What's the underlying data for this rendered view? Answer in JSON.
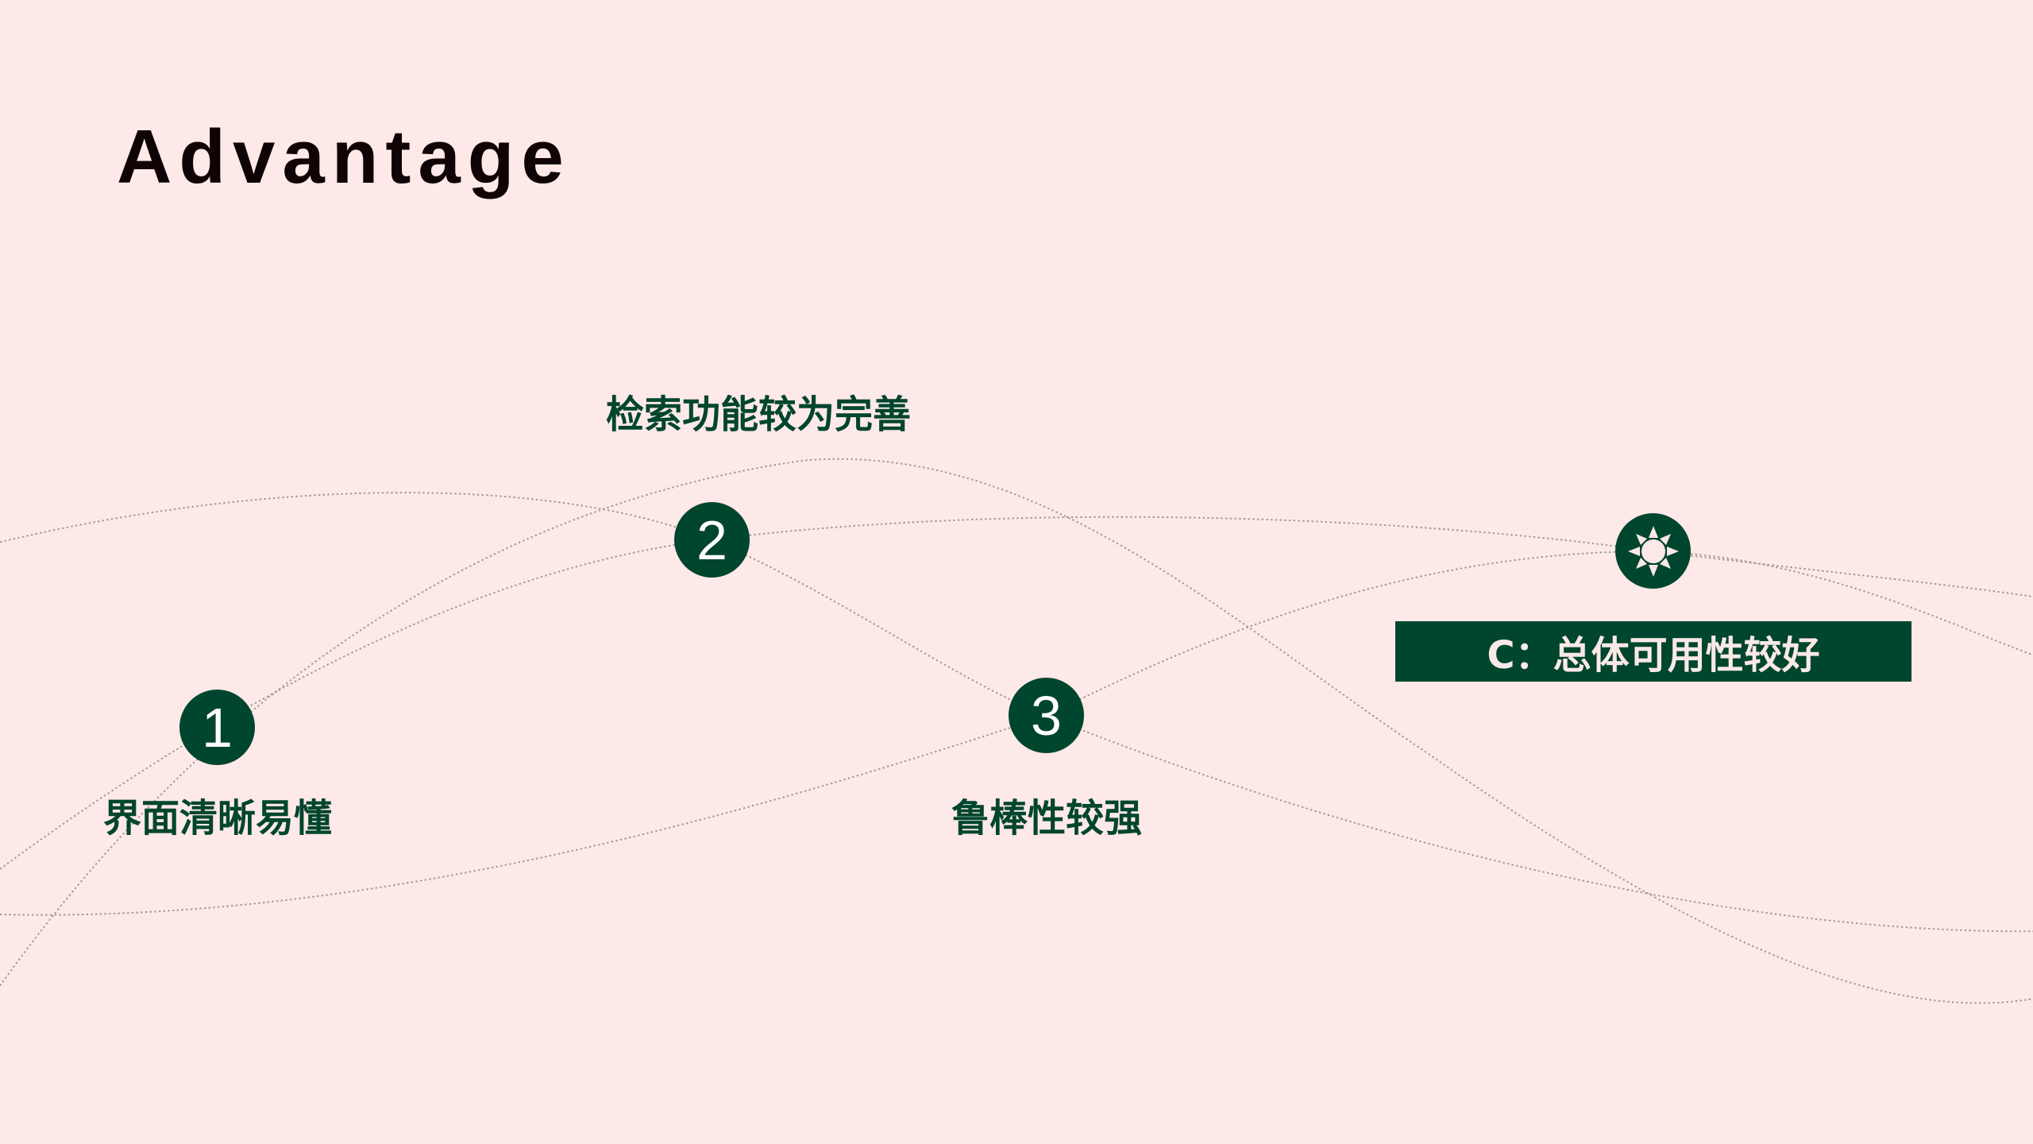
{
  "slide": {
    "title": "Advantage",
    "items": [
      {
        "number": "1",
        "label": "界面清晰易懂"
      },
      {
        "number": "2",
        "label": "检索功能较为完善"
      },
      {
        "number": "3",
        "label": "鲁棒性较强"
      }
    ],
    "conclusion": {
      "icon": "sun-icon",
      "text": "C：总体可用性较好"
    }
  },
  "colors": {
    "background": "#fde9e7",
    "accent": "#00452e",
    "curve": "#a09a9a"
  }
}
